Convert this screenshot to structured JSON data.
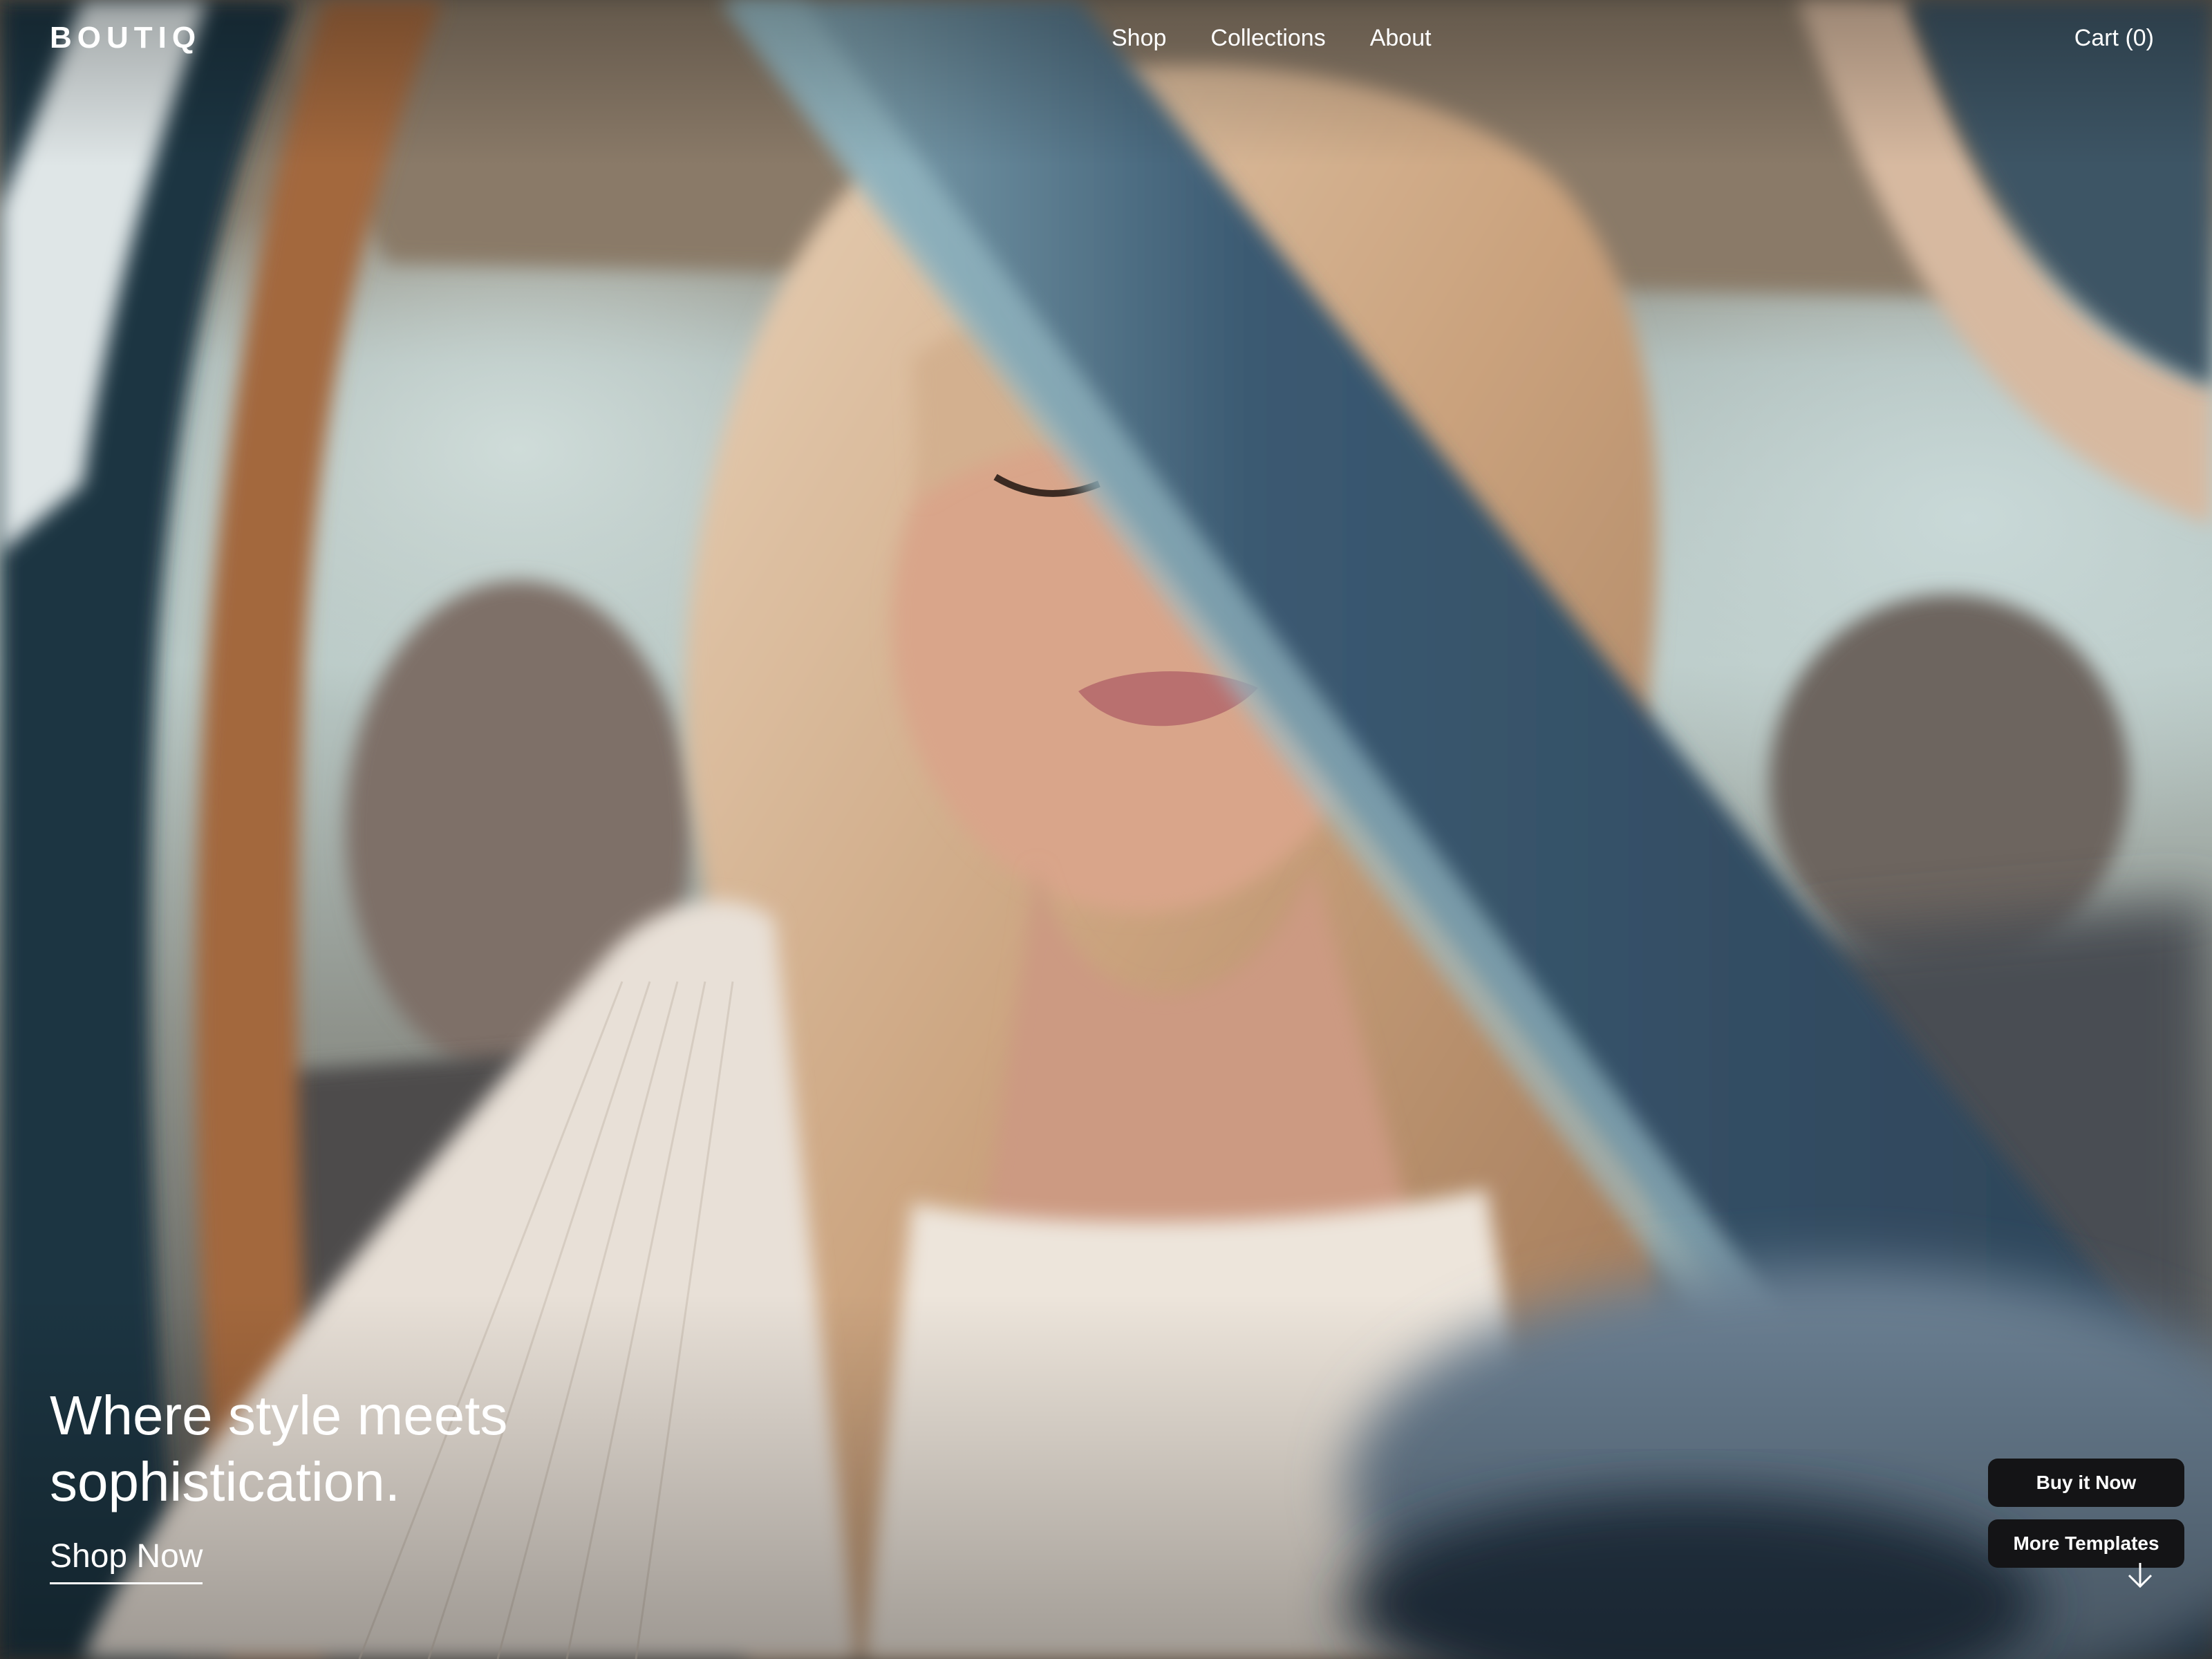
{
  "header": {
    "logo": "BOUTIQ",
    "nav": [
      {
        "label": "Shop"
      },
      {
        "label": "Collections"
      },
      {
        "label": "About"
      }
    ],
    "cart_label": "Cart (0)"
  },
  "hero": {
    "headline": "Where style meets sophistication.",
    "cta_label": "Shop Now",
    "image_alt": "Woman with long blonde wavy hair smiling inside a car, framed by the door"
  },
  "floating": {
    "buy_label": "Buy it Now",
    "templates_label": "More Templates",
    "scroll_icon": "arrow-down-icon"
  },
  "colors": {
    "text": "#ffffff",
    "button_bg": "#141416"
  }
}
